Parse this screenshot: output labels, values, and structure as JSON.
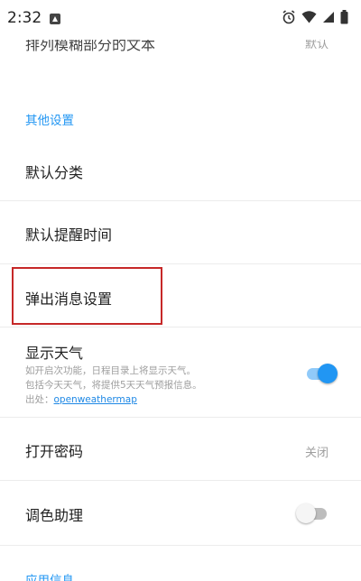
{
  "status_bar": {
    "time": "2:32",
    "icons": [
      "notification-app-icon",
      "alarm-icon",
      "wifi-icon",
      "signal-icon",
      "battery-icon"
    ]
  },
  "cutoff_top": {
    "label": "排列模糊部分的文本",
    "value": "默认"
  },
  "other_settings": {
    "header": "其他设置",
    "default_category": {
      "label": "默认分类"
    },
    "default_reminder_time": {
      "label": "默认提醒时间"
    },
    "popup_message_settings": {
      "label": "弹出消息设置"
    },
    "show_weather": {
      "label": "显示天气",
      "desc_line1": "如开启次功能，日程目录上将显示天气。",
      "desc_line2": "包括今天天气，将提供5天天气预报信息。",
      "source_prefix": "出处：",
      "source_link": "openweathermap",
      "enabled": true
    },
    "open_password": {
      "label": "打开密码",
      "value": "关闭"
    },
    "color_assist": {
      "label": "调色助理",
      "enabled": false
    }
  },
  "next_section": {
    "header": "应用信息"
  },
  "colors": {
    "accent": "#2196f3",
    "highlight_border": "#c62828"
  }
}
